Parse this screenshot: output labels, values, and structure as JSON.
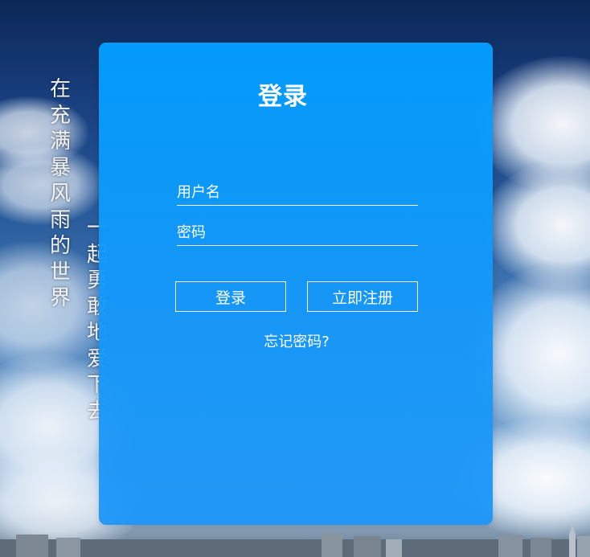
{
  "background": {
    "poem_lines": [
      "在充满暴风雨的世界",
      "一起勇敢地爱下去"
    ]
  },
  "login": {
    "title": "登录",
    "username_placeholder": "用户名",
    "password_placeholder": "密码",
    "login_button": "登录",
    "register_button": "立即注册",
    "forgot_link": "忘记密码?"
  },
  "colors": {
    "panel": "#039eff",
    "text": "#ffffff",
    "sky_top": "#0c2757"
  }
}
